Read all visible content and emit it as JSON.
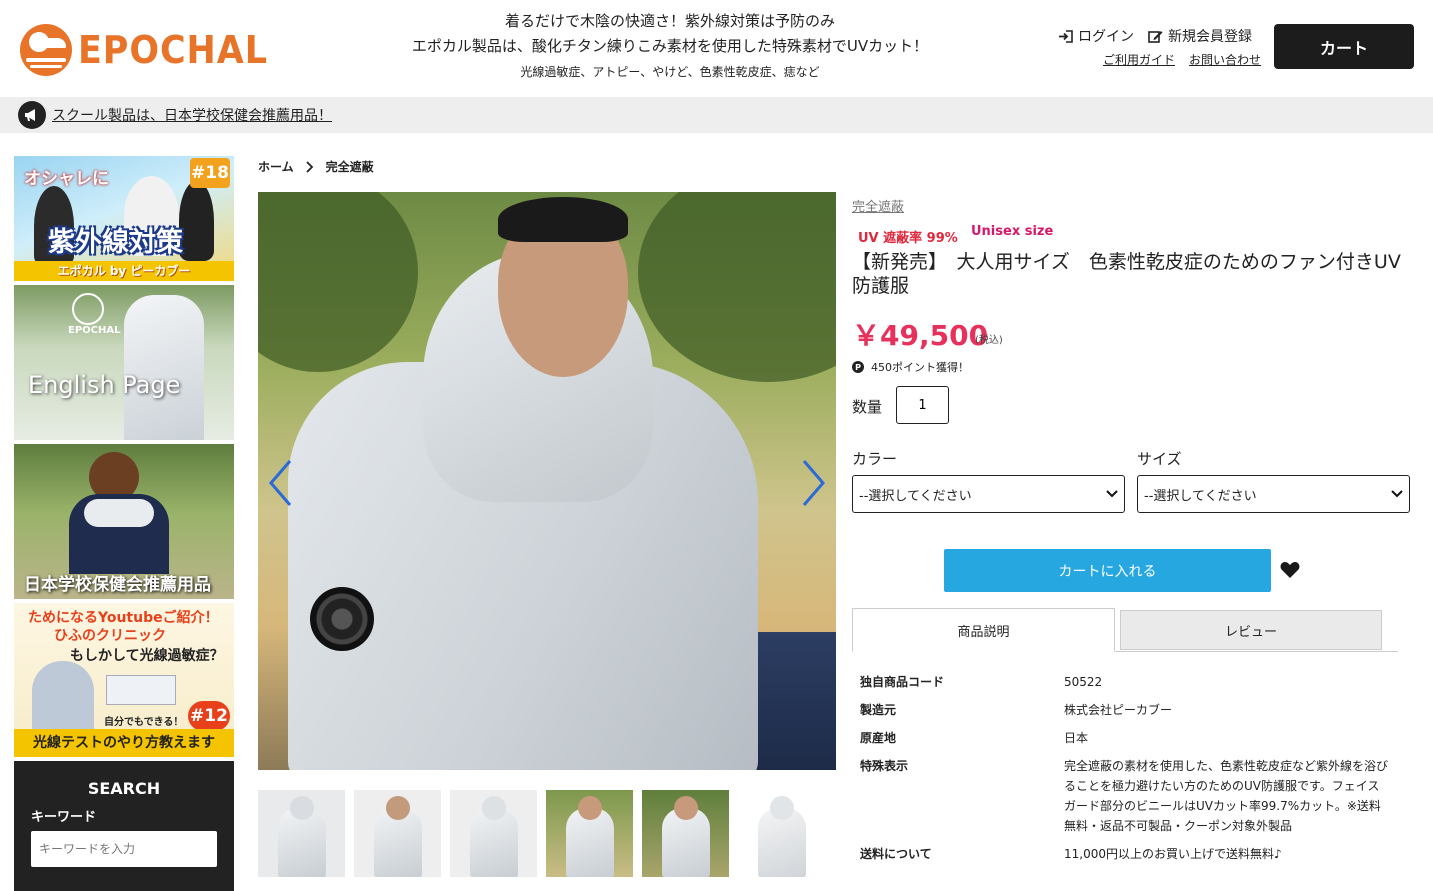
{
  "header": {
    "logo_text": "EPOCHAL",
    "tagline_1": "着るだけで木陰の快適さ！紫外線対策は予防のみ",
    "tagline_2": "エポカル製品は、酸化チタン練りこみ素材を使用した特殊素材でUVカット！",
    "tagline_3": "光線過敏症、アトピー、やけど、色素性乾皮症、痣など",
    "login_label": "ログイン",
    "register_label": "新規会員登録",
    "guide_label": "ご利用ガイド",
    "contact_label": "お問い合わせ",
    "cart_label": "カート"
  },
  "notice": {
    "text": "スクール製品は、日本学校保健会推薦用品！"
  },
  "sidebar": {
    "banner1": {
      "header": "オシャレに",
      "number": "#18",
      "title": "紫外線対策",
      "strip": "エポカル by ピーカブー"
    },
    "banner2": {
      "logo": "EPOCHAL",
      "title": "English Page"
    },
    "banner3": {
      "title": "日本学校保健会推薦用品"
    },
    "banner4": {
      "line1": "ためになるYoutubeご紹介！",
      "line2": "ひふのクリニック",
      "line3": "もしかして光線過敏症？",
      "line4": "自分でもできる！",
      "number": "#12",
      "strip": "光線テストのやり方教えます"
    },
    "search": {
      "title": "SEARCH",
      "label": "キーワード",
      "placeholder": "キーワードを入力"
    }
  },
  "breadcrumb": {
    "home": "ホーム",
    "current": "完全遮蔽"
  },
  "product": {
    "category": "完全遮蔽",
    "badge_uv": "UV 遮蔽率 99%",
    "badge_size": "Unisex size",
    "title": "【新発売】　大人用サイズ　色素性乾皮症のためのファン付きUV防護服",
    "price": "￥49,500",
    "tax_note": "(税込)",
    "points_icon": "P",
    "points": "450ポイント獲得！",
    "quantity_label": "数量",
    "quantity_value": "1",
    "color_label": "カラー",
    "color_selected": "--選択してください",
    "size_label": "サイズ",
    "size_selected": "--選択してください",
    "add_to_cart": "カートに入れる"
  },
  "tabs": [
    {
      "label": "商品説明"
    },
    {
      "label": "レビュー"
    }
  ],
  "specs": [
    {
      "key": "独自商品コード",
      "value": "50522"
    },
    {
      "key": "製造元",
      "value": "株式会社ピーカブー"
    },
    {
      "key": "原産地",
      "value": "日本"
    },
    {
      "key": "特殊表示",
      "value": "完全遮蔽の素材を使用した、色素性乾皮症など紫外線を浴びることを極力避けたい方のためのUV防護服です。フェイスガード部分のビニールはUVカット率99.7%カット。※送料無料・返品不可製品・クーポン対象外製品"
    },
    {
      "key": "送料について",
      "value": "11,000円以上のお買い上げで送料無料♪"
    }
  ],
  "colors": {
    "brand_orange": "#e8742a",
    "price_pink": "#e8305c",
    "cart_blue": "#26a7df",
    "dark": "#1c1c1c"
  }
}
